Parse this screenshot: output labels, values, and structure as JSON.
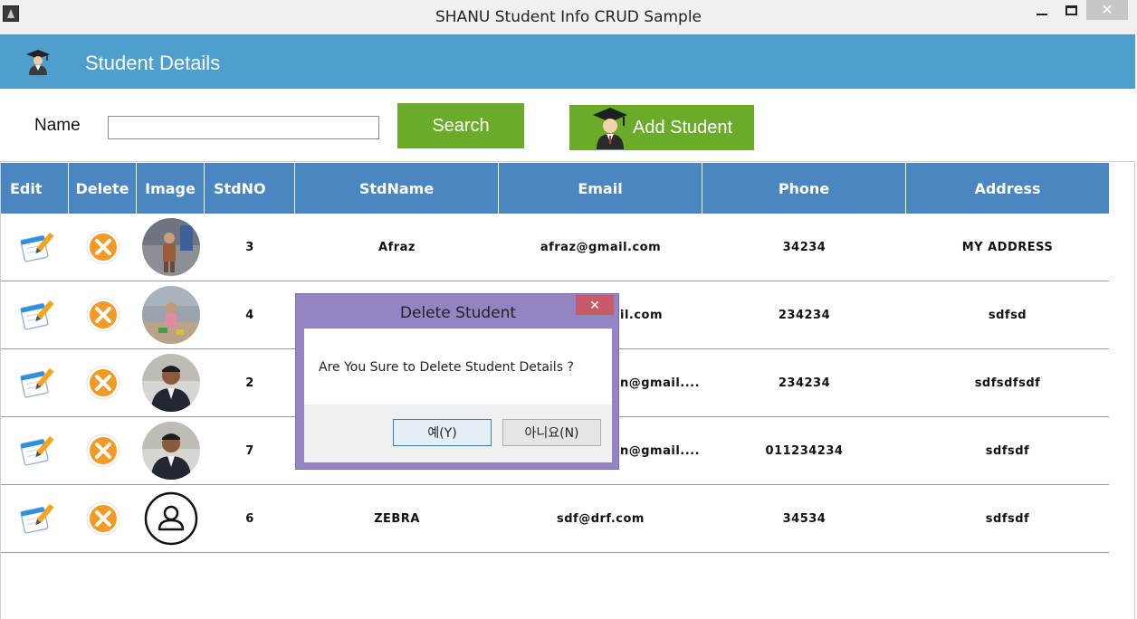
{
  "window": {
    "title": "SHANU Student Info CRUD Sample",
    "close_glyph": "✕"
  },
  "header": {
    "title": "Student Details"
  },
  "search": {
    "label": "Name",
    "value": "",
    "placeholder": "",
    "button_label": "Search"
  },
  "add_button_label": "Add Student",
  "colors": {
    "header_bg": "#4e9fce",
    "button_green": "#6aac2a",
    "grid_header_bg": "#4a87c0",
    "dialog_frame": "#9484c4",
    "delete_orange": "#f39a24"
  },
  "table": {
    "headers": [
      "Edit",
      "Delete",
      "Image",
      "StdNO",
      "StdName",
      "Email",
      "Phone",
      "Address"
    ],
    "rows": [
      {
        "std_no": "3",
        "name": "Afraz",
        "email": "afraz@gmail.com",
        "phone": "34234",
        "address": "MY ADDRESS",
        "image": "photo-child"
      },
      {
        "std_no": "4",
        "name": "",
        "email": "il.com",
        "phone": "234234",
        "address": "sdfsd",
        "image": "photo-child-beach"
      },
      {
        "std_no": "2",
        "name": "",
        "email": "n@gmail....",
        "phone": "234234",
        "address": "sdfsdfsdf",
        "image": "photo-man"
      },
      {
        "std_no": "7",
        "name": "",
        "email": "n@gmail....",
        "phone": "011234234",
        "address": "sdfsdf",
        "image": "photo-man"
      },
      {
        "std_no": "6",
        "name": "ZEBRA",
        "email": "sdf@drf.com",
        "phone": "34534",
        "address": "sdfsdf",
        "image": "user-placeholder-icon"
      }
    ]
  },
  "dialog": {
    "title": "Delete Student",
    "close_glyph": "✕",
    "message": "Are You Sure to Delete Student Details ?",
    "yes_label": "예(Y)",
    "no_label": "아니요(N)"
  }
}
